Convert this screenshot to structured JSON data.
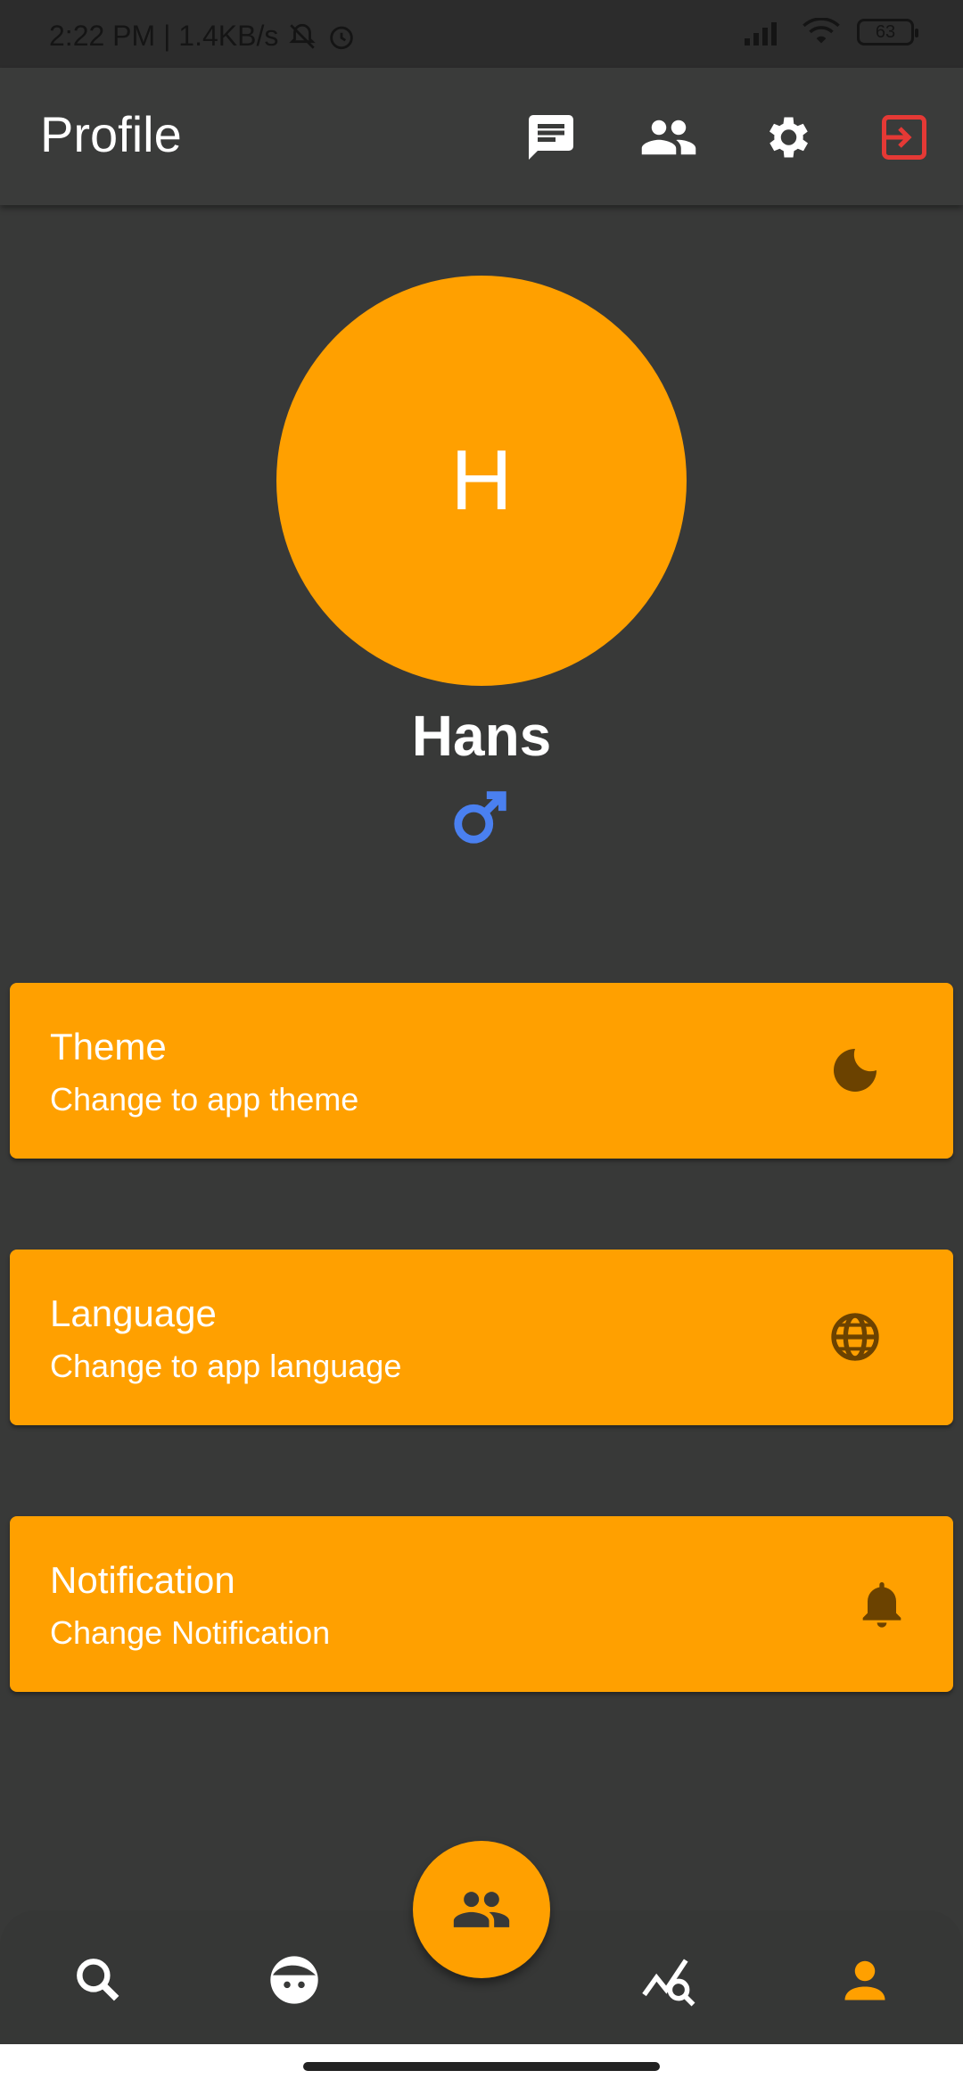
{
  "status_bar": {
    "time": "2:22 PM | 1.4KB/s",
    "battery": "63",
    "icons": [
      "mute-icon",
      "alarm-icon",
      "signal-icon",
      "wifi-icon",
      "battery-icon"
    ]
  },
  "app_bar": {
    "title": "Profile",
    "actions": [
      "chat-icon",
      "people-icon",
      "settings-icon",
      "logout-icon"
    ]
  },
  "profile": {
    "avatar_letter": "H",
    "name": "Hans",
    "gender_icon": "male-icon",
    "gender_color": "#4A80F0"
  },
  "settings": [
    {
      "title": "Theme",
      "subtitle": "Change to app theme",
      "icon": "moon-icon"
    },
    {
      "title": "Language",
      "subtitle": "Change to app language",
      "icon": "globe-icon"
    },
    {
      "title": "Notification",
      "subtitle": "Change Notification",
      "icon": "bell-icon"
    }
  ],
  "bottom_nav": {
    "items": [
      "search-icon",
      "face-icon",
      "people-icon",
      "chart-search-icon",
      "person-icon"
    ],
    "active": "person-icon"
  },
  "colors": {
    "accent": "#FFA000",
    "background": "#383938",
    "app_bar": "#3A3B3A",
    "logout": "#E53935",
    "card_icon": "#6B4200"
  }
}
